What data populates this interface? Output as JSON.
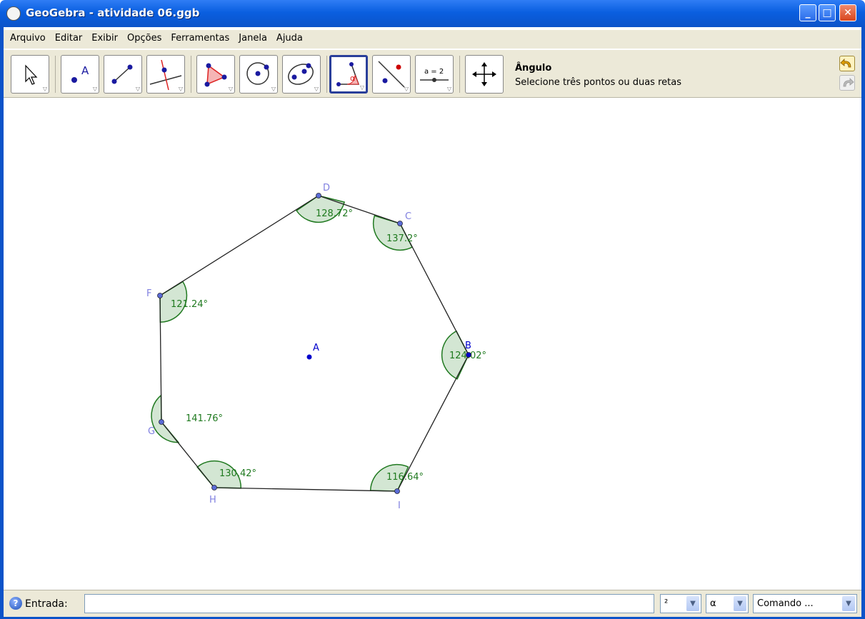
{
  "window": {
    "title": "GeoGebra - atividade 06.ggb"
  },
  "menu": [
    "Arquivo",
    "Editar",
    "Exibir",
    "Opções",
    "Ferramentas",
    "Janela",
    "Ajuda"
  ],
  "toolbar": {
    "tools": [
      "move-tool",
      "point-tool",
      "segment-tool",
      "perpendicular-line-tool",
      "polygon-tool",
      "circle-tool",
      "conic-tool",
      "angle-tool",
      "reflect-tool",
      "slider-tool",
      "move-graphics-view-tool"
    ],
    "active_tool": "angle-tool",
    "slider_tool_text": "a = 2",
    "angle_tool_symbol": "α",
    "help_title": "Ângulo",
    "help_text": "Selecione três pontos ou duas retas"
  },
  "points": [
    {
      "label": "A"
    },
    {
      "label": "B"
    },
    {
      "label": "C"
    },
    {
      "label": "D"
    },
    {
      "label": "F"
    },
    {
      "label": "G"
    },
    {
      "label": "H"
    },
    {
      "label": "I"
    }
  ],
  "angles": [
    {
      "vertex": "D",
      "value": "128.72°"
    },
    {
      "vertex": "C",
      "value": "137.2°"
    },
    {
      "vertex": "F",
      "value": "121.24°"
    },
    {
      "vertex": "B",
      "value": "124.02°"
    },
    {
      "vertex": "G",
      "value": "141.76°"
    },
    {
      "vertex": "H",
      "value": "130.42°"
    },
    {
      "vertex": "I",
      "value": "116.64°"
    }
  ],
  "colors": {
    "point": "#5a6bd6",
    "point_label": "#8080e0",
    "center_point": "#0000cc",
    "angle_stroke": "#217a21",
    "angle_fill": "#d3e6d3",
    "angle_text": "#1f7a1f",
    "polygon_edge": "#222222"
  },
  "input_bar": {
    "label": "Entrada:",
    "value": "",
    "combo_superscript": "²",
    "combo_greek": "α",
    "combo_command": "Comando ..."
  }
}
